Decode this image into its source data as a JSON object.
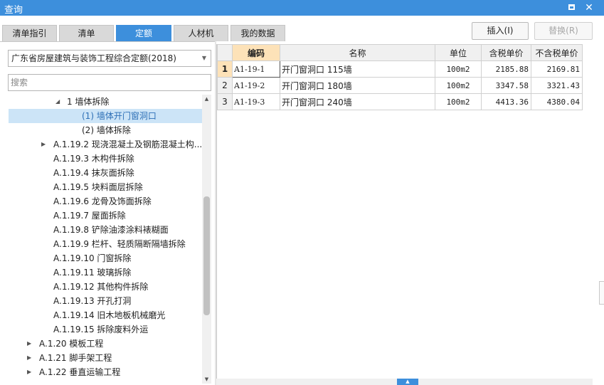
{
  "window": {
    "title": "查询",
    "maximize_label": "▢",
    "close_label": "✕"
  },
  "tabs": [
    {
      "label": "清单指引",
      "active": false
    },
    {
      "label": "清单",
      "active": false
    },
    {
      "label": "定额",
      "active": true
    },
    {
      "label": "人材机",
      "active": false
    },
    {
      "label": "我的数据",
      "active": false
    }
  ],
  "toolbar": {
    "insert_label": "插入(I)",
    "replace_label": "替换(R)"
  },
  "left": {
    "quota_library": "广东省房屋建筑与装饰工程综合定额(2018)",
    "search_placeholder": "搜索",
    "tree": [
      {
        "label": "1 墙体拆除",
        "toggle": "expanded"
      },
      {
        "label": "(1) 墙体开门窗洞口",
        "selected": true
      },
      {
        "label": "(2) 墙体拆除"
      },
      {
        "label": "A.1.19.2 现浇混凝土及钢筋混凝土构...",
        "toggle": "collapsed"
      },
      {
        "label": "A.1.19.3 木构件拆除"
      },
      {
        "label": "A.1.19.4 抹灰面拆除"
      },
      {
        "label": "A.1.19.5 块料面层拆除"
      },
      {
        "label": "A.1.19.6 龙骨及饰面拆除"
      },
      {
        "label": "A.1.19.7 屋面拆除"
      },
      {
        "label": "A.1.19.8 铲除油漆涂料裱糊面"
      },
      {
        "label": "A.1.19.9 栏杆、轻质隔断隔墙拆除"
      },
      {
        "label": "A.1.19.10 门窗拆除"
      },
      {
        "label": "A.1.19.11 玻璃拆除"
      },
      {
        "label": "A.1.19.12 其他构件拆除"
      },
      {
        "label": "A.1.19.13 开孔打洞"
      },
      {
        "label": "A.1.19.14 旧木地板机械磨光"
      },
      {
        "label": "A.1.19.15 拆除废料外运"
      },
      {
        "label": "A.1.20 模板工程",
        "toggle": "collapsed"
      },
      {
        "label": "A.1.21 脚手架工程",
        "toggle": "collapsed"
      },
      {
        "label": "A.1.22 垂直运输工程",
        "toggle": "collapsed"
      }
    ]
  },
  "table": {
    "columns": [
      "编码",
      "名称",
      "单位",
      "含税单价",
      "不含税单价"
    ],
    "rows": [
      {
        "no": "1",
        "code": "A1-19-1",
        "name": "开门窗洞口 115墙",
        "unit": "100m2",
        "price_tax": "2185.88",
        "price_notax": "2169.81"
      },
      {
        "no": "2",
        "code": "A1-19-2",
        "name": "开门窗洞口 180墙",
        "unit": "100m2",
        "price_tax": "3347.58",
        "price_notax": "3321.43"
      },
      {
        "no": "3",
        "code": "A1-19-3",
        "name": "开门窗洞口 240墙",
        "unit": "100m2",
        "price_tax": "4413.36",
        "price_notax": "4380.04"
      }
    ]
  },
  "colors": {
    "accent": "#3d8fdc",
    "header_highlight": "#fde2b8",
    "selected_row": "#cce4f7"
  }
}
